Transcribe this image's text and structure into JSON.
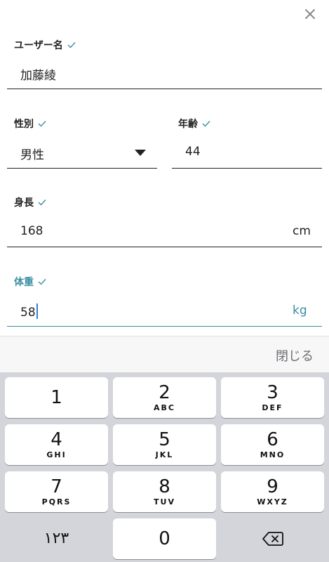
{
  "form": {
    "username": {
      "label": "ユーザー名",
      "value": "加藤綾"
    },
    "gender": {
      "label": "性別",
      "value": "男性"
    },
    "age": {
      "label": "年齢",
      "value": "44"
    },
    "height": {
      "label": "身長",
      "value": "168",
      "unit": "cm"
    },
    "weight": {
      "label": "体重",
      "value": "58",
      "unit": "kg"
    }
  },
  "toolbar": {
    "done_label": "閉じる"
  },
  "keyboard": {
    "keys": [
      {
        "digit": "1",
        "letters": ""
      },
      {
        "digit": "2",
        "letters": "ABC"
      },
      {
        "digit": "3",
        "letters": "DEF"
      },
      {
        "digit": "4",
        "letters": "GHI"
      },
      {
        "digit": "5",
        "letters": "JKL"
      },
      {
        "digit": "6",
        "letters": "MNO"
      },
      {
        "digit": "7",
        "letters": "PQRS"
      },
      {
        "digit": "8",
        "letters": "TUV"
      },
      {
        "digit": "9",
        "letters": "WXYZ"
      }
    ],
    "zero": "0",
    "switch_label": "١٢٣"
  },
  "colors": {
    "accent": "#3a8fa3",
    "caret": "#2f7fd8",
    "keyboard_bg": "#d3d5db"
  },
  "icons": {
    "close": "close-icon",
    "check": "checkmark-icon",
    "dropdown": "dropdown-arrow-icon",
    "backspace": "backspace-icon"
  }
}
